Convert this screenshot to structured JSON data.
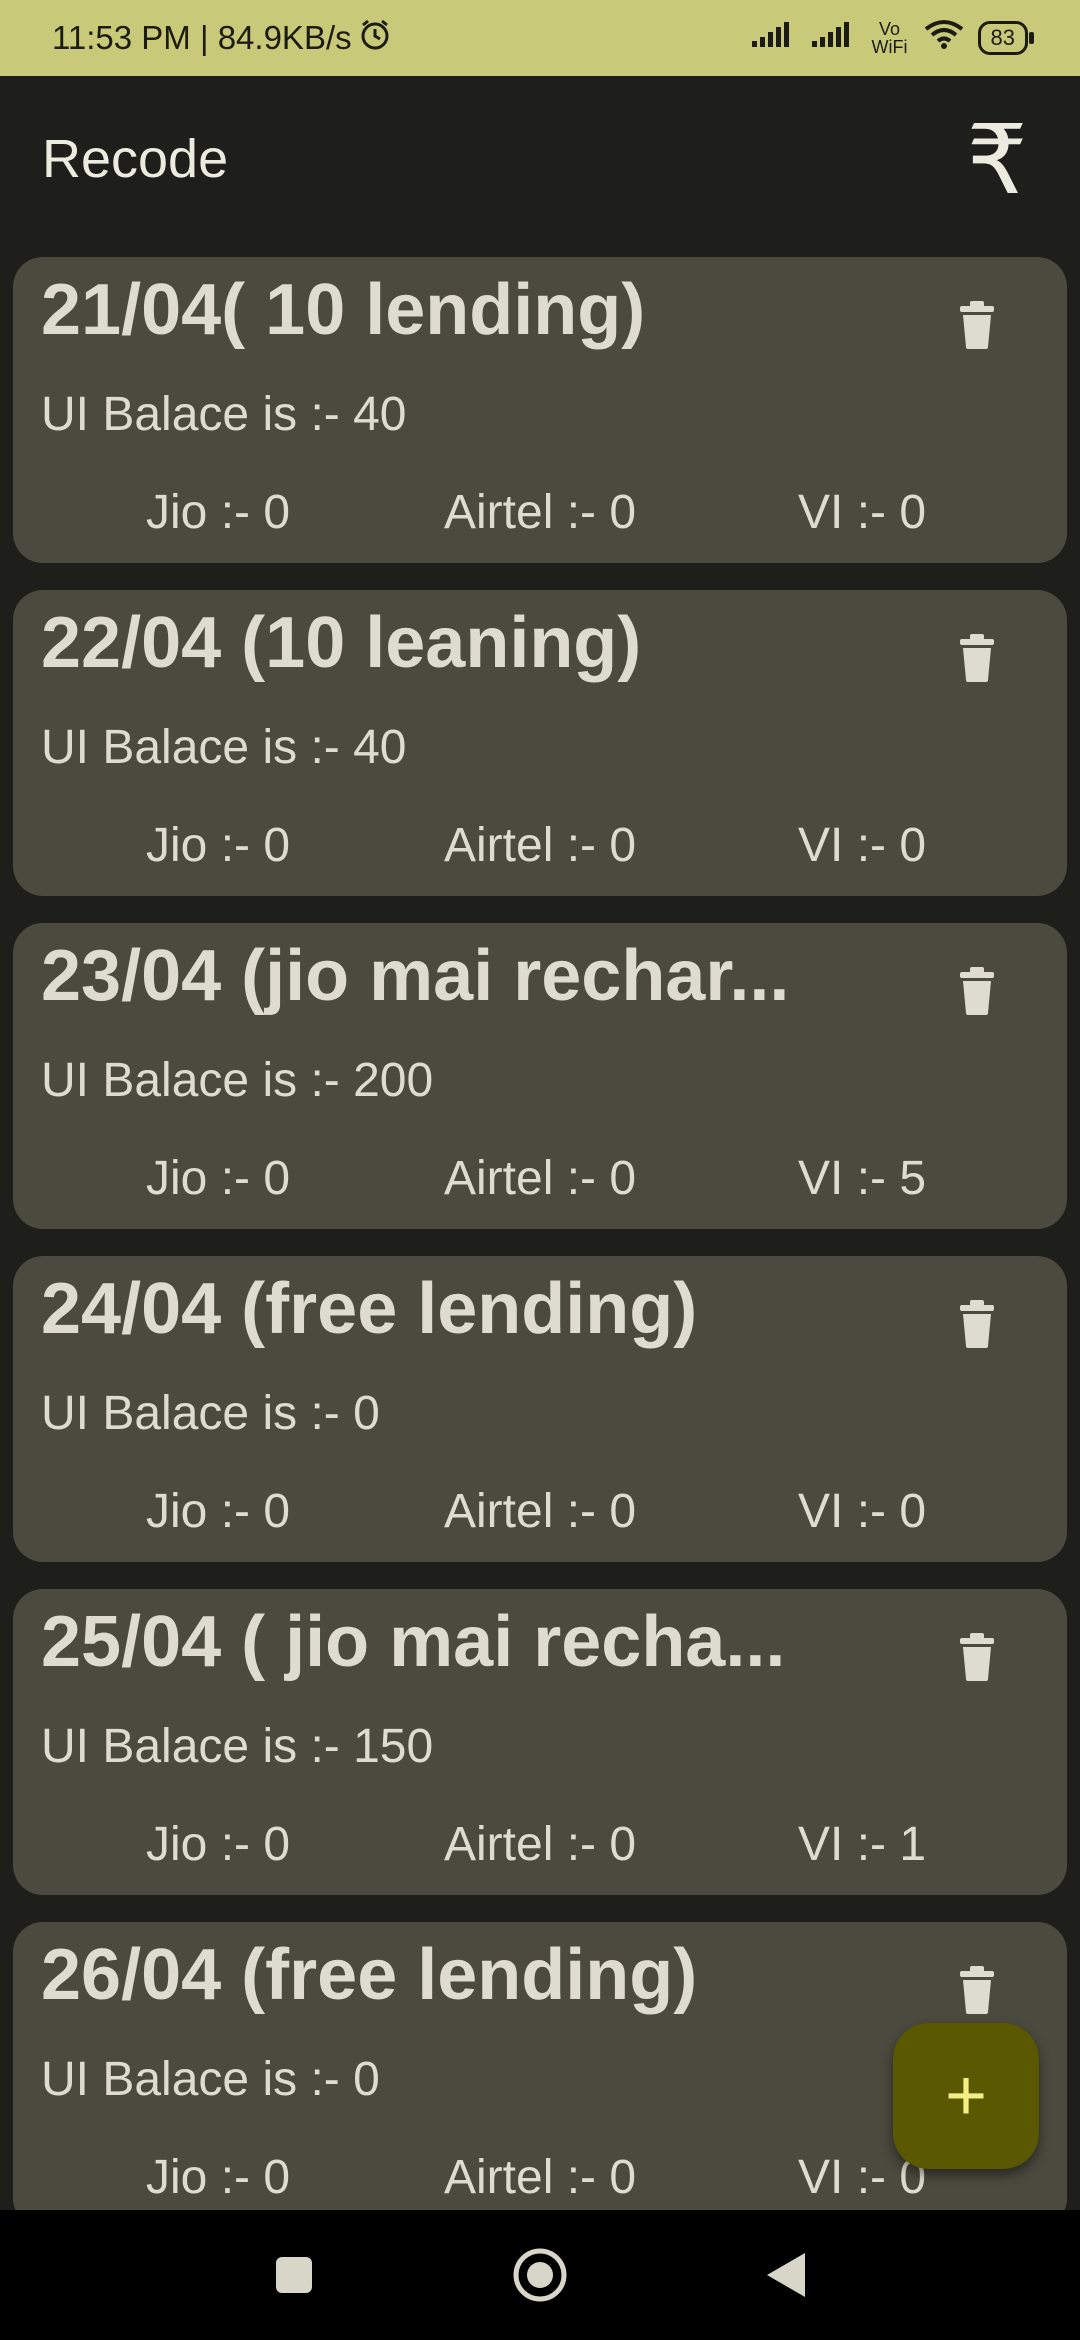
{
  "status_bar": {
    "time_speed": "11:53 PM | 84.9KB/s",
    "network": "Vo WiFi",
    "battery": "83"
  },
  "app_bar": {
    "title": "Recode",
    "currency_symbol": "₹"
  },
  "records": [
    {
      "title": "21/04( 10 lending)",
      "balance": "UI Balace is :- 40",
      "jio": "Jio :- 0",
      "airtel": "Airtel :- 0",
      "vi": "VI :- 0"
    },
    {
      "title": "22/04 (10 leaning)",
      "balance": "UI Balace is :- 40",
      "jio": "Jio :- 0",
      "airtel": "Airtel :- 0",
      "vi": "VI :- 0"
    },
    {
      "title": "23/04 (jio mai rechar...",
      "balance": "UI Balace is :- 200",
      "jio": "Jio :- 0",
      "airtel": "Airtel :- 0",
      "vi": "VI :- 5"
    },
    {
      "title": "24/04 (free lending)",
      "balance": "UI Balace is :- 0",
      "jio": "Jio :- 0",
      "airtel": "Airtel :- 0",
      "vi": "VI :- 0"
    },
    {
      "title": "25/04 ( jio mai recha...",
      "balance": "UI Balace is :- 150",
      "jio": "Jio :- 0",
      "airtel": "Airtel :- 0",
      "vi": "VI :- 1"
    },
    {
      "title": "26/04 (free lending)",
      "balance": "UI Balace is :- 0",
      "jio": "Jio :- 0",
      "airtel": "Airtel :- 0",
      "vi": "VI :- 0"
    }
  ],
  "fab": {
    "label": "+"
  },
  "colors": {
    "accent": "#5a5800",
    "card": "#4a4a3e",
    "background": "#1e1f1a",
    "status_bar": "#c9c97a"
  },
  "icons": {
    "delete": "trash-icon",
    "add": "plus-icon",
    "currency": "rupee-icon"
  }
}
